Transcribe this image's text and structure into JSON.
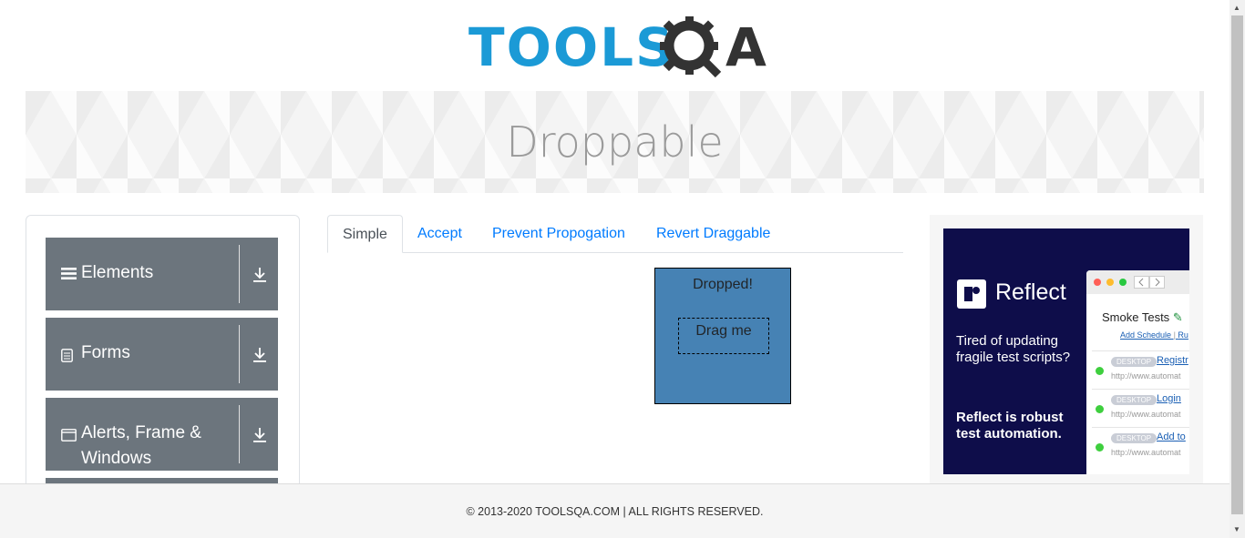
{
  "logo": {
    "text_left": "TOOLS",
    "text_right": "A"
  },
  "banner": {
    "title": "Droppable"
  },
  "sidebar": {
    "groups": [
      {
        "label": "Elements",
        "icon": "hamburger-icon"
      },
      {
        "label": "Forms",
        "icon": "document-icon"
      },
      {
        "label": "Alerts, Frame & Windows",
        "icon": "window-icon"
      }
    ]
  },
  "tabs": [
    "Simple",
    "Accept",
    "Prevent Propogation",
    "Revert Draggable"
  ],
  "droppable": {
    "text": "Dropped!"
  },
  "draggable": {
    "text": "Drag me"
  },
  "ad": {
    "brand": "Reflect",
    "headline": "Tired of updating fragile test scripts?",
    "tagline": "Reflect is robust test automation.",
    "window_title": "Smoke Tests",
    "add_schedule": "Add Schedule",
    "run": "Ru",
    "rows": [
      {
        "badge": "DESKTOP",
        "link": "Registr",
        "url": "http://www.automat"
      },
      {
        "badge": "DESKTOP",
        "link": "Login",
        "url": "http://www.automat"
      },
      {
        "badge": "DESKTOP",
        "link": "Add to",
        "url": "http://www.automat"
      }
    ]
  },
  "footer": {
    "text": "© 2013-2020 TOOLSQA.COM | ALL RIGHTS RESERVED."
  },
  "colors": {
    "accent": "#007bff",
    "sidebar_group": "#6c757d",
    "drop_target": "#4682b4",
    "logo_blue": "#1b9ad6"
  }
}
